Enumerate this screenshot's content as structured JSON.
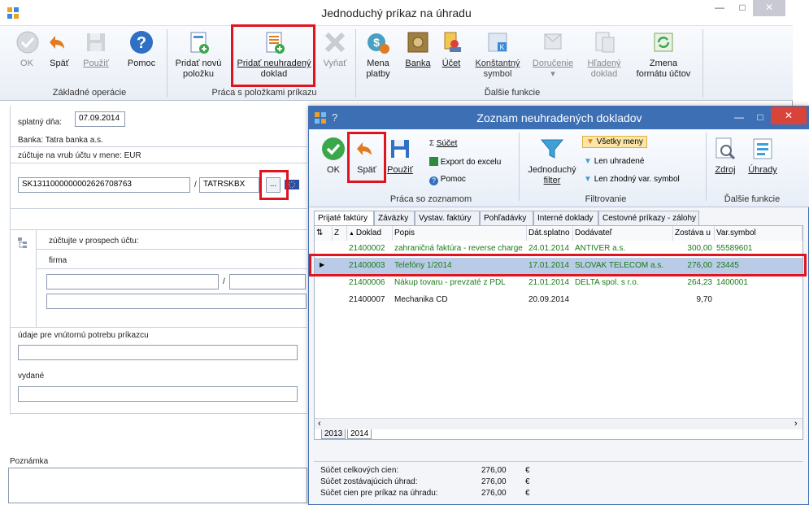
{
  "main": {
    "title": "Jednoduchý príkaz na úhradu",
    "ribbon": {
      "ok": "OK",
      "spat": "Späť",
      "pouzit": "Použiť",
      "pomoc": "Pomoc",
      "group_basic": "Základné operácie",
      "pridat_novu_1": "Pridať novú",
      "pridat_novu_2": "položku",
      "pridat_neuhr_1": "Pridať neuhradený",
      "pridat_neuhr_2": "doklad",
      "vyniat": "Vyňať",
      "group_items": "Práca s položkami príkazu",
      "mena_1": "Mena",
      "mena_2": "platby",
      "banka": "Banka",
      "ucet": "Účet",
      "konst_1": "Konštantný",
      "konst_2": "symbol",
      "dorucenie": "Doručenie",
      "hladeny_1": "Hľadený",
      "hladeny_2": "doklad",
      "zmena_1": "Zmena",
      "zmena_2": "formátu účtov",
      "group_more": "Ďalšie funkcie"
    },
    "form": {
      "splatny_label": "splatný dňa:",
      "splatny_value": "07.09.2014",
      "banka_line": "Banka:  Tatra banka a.s.",
      "zuctuje_vrub": "zúčtuje na vrub účtu v mene:  EUR",
      "iban": "SK1311000000002626708763",
      "slash": "/",
      "bic": "TATRSKBX",
      "ellipsis": "...",
      "zuctujte_prospech": "zúčtujte v prospech účtu:",
      "firma": "firma",
      "udaje": "údaje pre vnútornú potrebu príkazcu",
      "vydane": "vydané",
      "poznamka": "Poznámka"
    }
  },
  "dialog": {
    "title": "Zoznam neuhradených dokladov",
    "ribbon": {
      "ok": "OK",
      "spat": "Späť",
      "pouzit": "Použiť",
      "sucet": "Súčet",
      "export": "Export do excelu",
      "pomoc": "Pomoc",
      "group_list": "Práca so zoznamom",
      "jednoduchy_1": "Jednoduchý",
      "jednoduchy_2": "filter",
      "vsetky_meny": "Všetky meny",
      "len_uhradene": "Len uhradené",
      "len_zhodny": "Len zhodný var. symbol",
      "group_filter": "Filtrovanie",
      "zdroj": "Zdroj",
      "uhrady": "Úhrady",
      "group_more": "Ďalšie funkcie"
    },
    "tabs": [
      "Prijaté faktúry",
      "Záväzky",
      "Vystav. faktúry",
      "Pohľadávky",
      "Interné doklady",
      "Cestovné príkazy - zálohy"
    ],
    "columns": {
      "z": "Z",
      "doklad": "Doklad",
      "popis": "Popis",
      "splatno": "Dát.splatno",
      "dodavatel": "Dodávateľ",
      "zostava": "Zostáva u",
      "varsymbol": "Var.symbol"
    },
    "rows": [
      {
        "doklad": "21400002",
        "popis": "zahraničná faktúra - reverse charge",
        "splatno": "24.01.2014",
        "dodavatel": "ANTIVER a.s.",
        "zostava": "300,00",
        "vs": "55589601",
        "color": "#1a7a1a"
      },
      {
        "doklad": "21400003",
        "popis": "Telefóny 1/2014",
        "splatno": "17.01.2014",
        "dodavatel": "SLOVAK TELECOM a.s.",
        "zostava": "276,00",
        "vs": "23445",
        "color": "#1a7a1a"
      },
      {
        "doklad": "21400006",
        "popis": "Nákup tovaru - prevzaté z PDL",
        "splatno": "21.01.2014",
        "dodavatel": "DELTA spol. s r.o.",
        "zostava": "264,23",
        "vs": "1400001",
        "color": "#1a7a1a"
      },
      {
        "doklad": "21400007",
        "popis": "Mechanika CD",
        "splatno": "20.09.2014",
        "dodavatel": "",
        "zostava": "9,70",
        "vs": "",
        "color": "#111111"
      }
    ],
    "year_tabs": [
      "2013",
      "2014"
    ],
    "summary": {
      "l1": "Súčet celkových cien:",
      "v1": "276,00",
      "c1": "€",
      "l2": "Súčet zostávajúcich úhrad:",
      "v2": "276,00",
      "c2": "€",
      "l3": "Súčet cien pre príkaz na úhradu:",
      "v3": "276,00",
      "c3": "€"
    }
  },
  "colors": {
    "accent": "#3d6fb5",
    "highlight_box": "#e0141e",
    "selected_row": "#b9cbe6"
  }
}
